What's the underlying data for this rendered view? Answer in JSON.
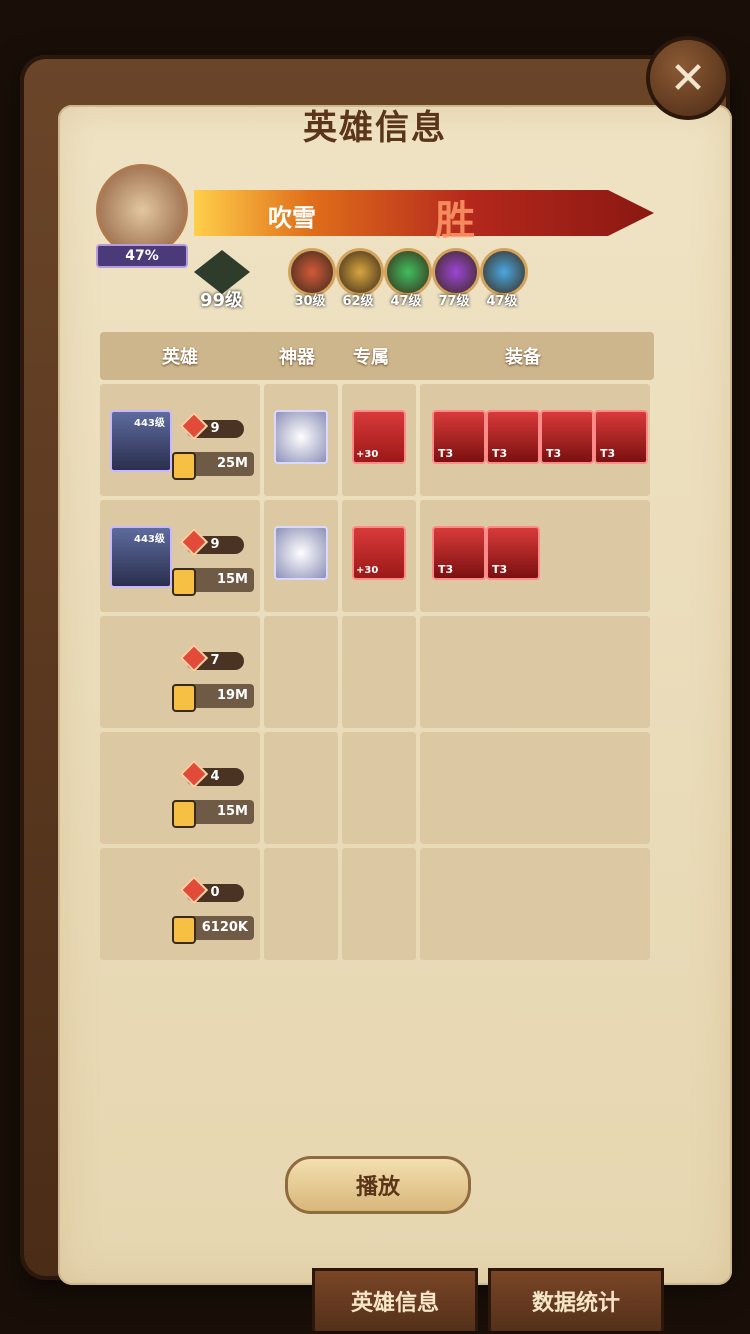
{
  "header": {
    "title": "英雄信息",
    "close_icon": "close-icon"
  },
  "player": {
    "name": "吹雪",
    "result_text": "胜",
    "percent": "47%",
    "level": "99级",
    "factions": [
      {
        "icon": "faction-lightbearer-icon",
        "color": "#d45a3a",
        "level": "30级"
      },
      {
        "icon": "faction-mauler-icon",
        "color": "#d9a640",
        "level": "62级"
      },
      {
        "icon": "faction-wilder-icon",
        "color": "#3fbf5f",
        "level": "47级"
      },
      {
        "icon": "faction-graveborn-icon",
        "color": "#9b46d6",
        "level": "77级"
      },
      {
        "icon": "faction-celestial-icon",
        "color": "#4aa7e2",
        "level": "47级"
      }
    ]
  },
  "table": {
    "headers": [
      "英雄",
      "神器",
      "专属",
      "装备"
    ],
    "rows": [
      {
        "hero_level": "443级",
        "gems": "9",
        "power": "25M",
        "has_artifact": true,
        "exclusive_plus": "+30",
        "equipment": [
          "T3",
          "T3",
          "T3",
          "T3"
        ]
      },
      {
        "hero_level": "443级",
        "gems": "9",
        "power": "15M",
        "has_artifact": true,
        "exclusive_plus": "+30",
        "equipment": [
          "T3",
          "T3"
        ]
      },
      {
        "hero_level": "",
        "gems": "7",
        "power": "19M",
        "has_artifact": false,
        "exclusive_plus": "",
        "equipment": []
      },
      {
        "hero_level": "",
        "gems": "4",
        "power": "15M",
        "has_artifact": false,
        "exclusive_plus": "",
        "equipment": []
      },
      {
        "hero_level": "",
        "gems": "0",
        "power": "6120K",
        "has_artifact": false,
        "exclusive_plus": "",
        "equipment": []
      }
    ]
  },
  "actions": {
    "play": "播放"
  },
  "tabs": {
    "hero_info": "英雄信息",
    "stats": "数据统计"
  }
}
